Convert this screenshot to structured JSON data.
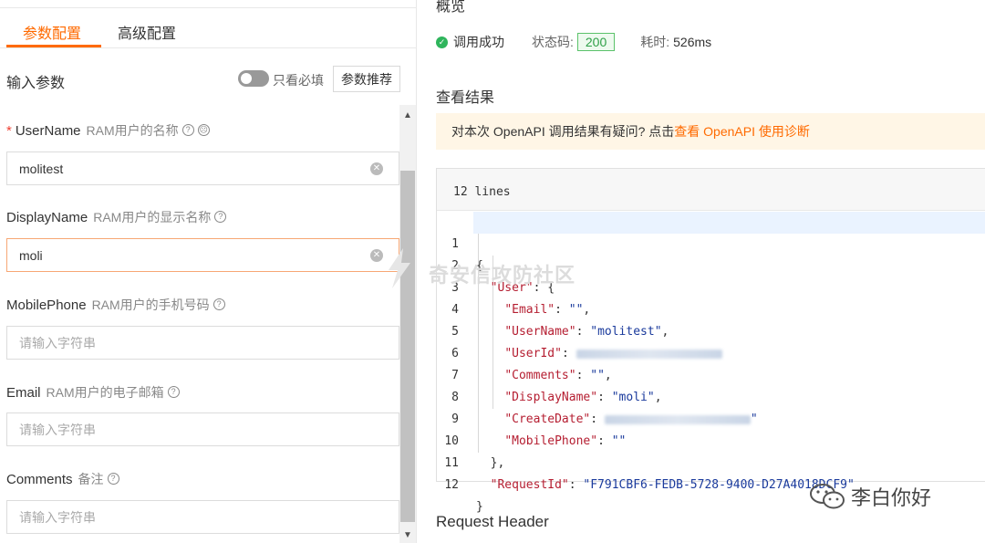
{
  "tabs": [
    {
      "label": "参数配置",
      "active": true
    },
    {
      "label": "高级配置",
      "active": false
    }
  ],
  "input_section": {
    "title": "输入参数",
    "toggle_label": "只看必填",
    "recommend_label": "参数推荐"
  },
  "params": [
    {
      "name": "UserName",
      "required": true,
      "desc": "RAM用户的名称",
      "value": "molitest",
      "placeholder": ""
    },
    {
      "name": "DisplayName",
      "required": false,
      "desc": "RAM用户的显示名称",
      "value": "moli",
      "placeholder": ""
    },
    {
      "name": "MobilePhone",
      "required": false,
      "desc": "RAM用户的手机号码",
      "value": "",
      "placeholder": "请输入字符串"
    },
    {
      "name": "Email",
      "required": false,
      "desc": "RAM用户的电子邮箱",
      "value": "",
      "placeholder": "请输入字符串"
    },
    {
      "name": "Comments",
      "required": false,
      "desc": "备注",
      "value": "",
      "placeholder": "请输入字符串"
    }
  ],
  "overview": {
    "title": "概览",
    "success_text": "调用成功",
    "status_label": "状态码:",
    "status_code": "200",
    "time_label": "耗时:",
    "time_value": "526ms"
  },
  "result": {
    "title": "查看结果",
    "notice_text": "对本次 OpenAPI 调用结果有疑问? 点击",
    "notice_link": "查看 OpenAPI 使用诊断",
    "lines_label": "12 lines",
    "code": [
      {
        "n": "1",
        "indent": 0,
        "key": "",
        "value": "",
        "text": "{"
      },
      {
        "n": "2",
        "indent": 1,
        "key": "\"User\"",
        "value": "",
        "text": ": {"
      },
      {
        "n": "3",
        "indent": 2,
        "key": "\"Email\"",
        "value": "\"\"",
        "text": ","
      },
      {
        "n": "4",
        "indent": 2,
        "key": "\"UserName\"",
        "value": "\"molitest\"",
        "text": ","
      },
      {
        "n": "5",
        "indent": 2,
        "key": "\"UserId\"",
        "value": "",
        "text": ":"
      },
      {
        "n": "6",
        "indent": 2,
        "key": "\"Comments\"",
        "value": "\"\"",
        "text": ","
      },
      {
        "n": "7",
        "indent": 2,
        "key": "\"DisplayName\"",
        "value": "\"moli\"",
        "text": ","
      },
      {
        "n": "8",
        "indent": 2,
        "key": "\"CreateDate\"",
        "value": "\"",
        "text": ":"
      },
      {
        "n": "9",
        "indent": 2,
        "key": "\"MobilePhone\"",
        "value": "\"\"",
        "text": ""
      },
      {
        "n": "10",
        "indent": 1,
        "key": "",
        "value": "",
        "text": "},"
      },
      {
        "n": "11",
        "indent": 1,
        "key": "\"RequestId\"",
        "value": "\"F791CBF6-FEDB-5728-9400-D27A4018DCF9\"",
        "text": ""
      },
      {
        "n": "12",
        "indent": 0,
        "key": "",
        "value": "",
        "text": "}"
      }
    ]
  },
  "request_header_title": "Request Header",
  "watermarks": {
    "center": "奇安信攻防社区",
    "corner": "李白你好"
  },
  "colors": {
    "accent": "#ff6a00",
    "success": "#2fb55c",
    "json_key": "#b51e31",
    "json_string": "#1a3a9c"
  }
}
